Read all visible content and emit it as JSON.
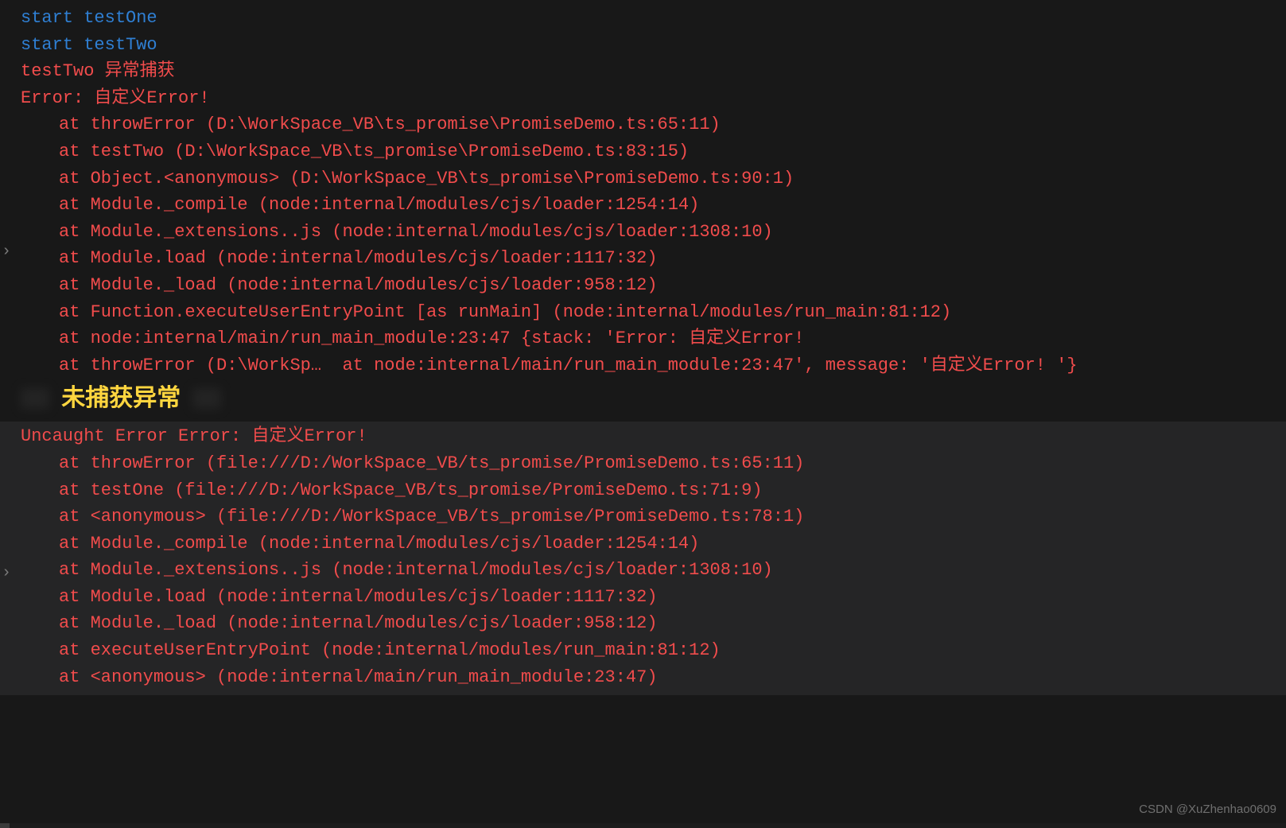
{
  "log": {
    "start_one": "start testOne",
    "start_two": "start testTwo",
    "caught": "testTwo 异常捕获",
    "err_head": "Error: 自定义Error!",
    "stack": [
      "at throwError (D:\\WorkSpace_VB\\ts_promise\\PromiseDemo.ts:65:11)",
      "at testTwo (D:\\WorkSpace_VB\\ts_promise\\PromiseDemo.ts:83:15)",
      "at Object.<anonymous> (D:\\WorkSpace_VB\\ts_promise\\PromiseDemo.ts:90:1)",
      "at Module._compile (node:internal/modules/cjs/loader:1254:14)",
      "at Module._extensions..js (node:internal/modules/cjs/loader:1308:10)",
      "at Module.load (node:internal/modules/cjs/loader:1117:32)",
      "at Module._load (node:internal/modules/cjs/loader:958:12)",
      "at Function.executeUserEntryPoint [as runMain] (node:internal/modules/run_main:81:12)",
      "at node:internal/main/run_main_module:23:47 {stack: 'Error: 自定义Error!",
      "at throwError (D:\\WorkSp…  at node:internal/main/run_main_module:23:47', message: '自定义Error! '}"
    ]
  },
  "label": "未捕获异常",
  "uncaught": {
    "head": "Uncaught Error Error: 自定义Error!",
    "stack": [
      "at throwError (file:///D:/WorkSpace_VB/ts_promise/PromiseDemo.ts:65:11)",
      "at testOne (file:///D:/WorkSpace_VB/ts_promise/PromiseDemo.ts:71:9)",
      "at <anonymous> (file:///D:/WorkSpace_VB/ts_promise/PromiseDemo.ts:78:1)",
      "at Module._compile (node:internal/modules/cjs/loader:1254:14)",
      "at Module._extensions..js (node:internal/modules/cjs/loader:1308:10)",
      "at Module.load (node:internal/modules/cjs/loader:1117:32)",
      "at Module._load (node:internal/modules/cjs/loader:958:12)",
      "at executeUserEntryPoint (node:internal/modules/run_main:81:12)",
      "at <anonymous> (node:internal/main/run_main_module:23:47)"
    ]
  },
  "watermark": "CSDN @XuZhenhao0609"
}
